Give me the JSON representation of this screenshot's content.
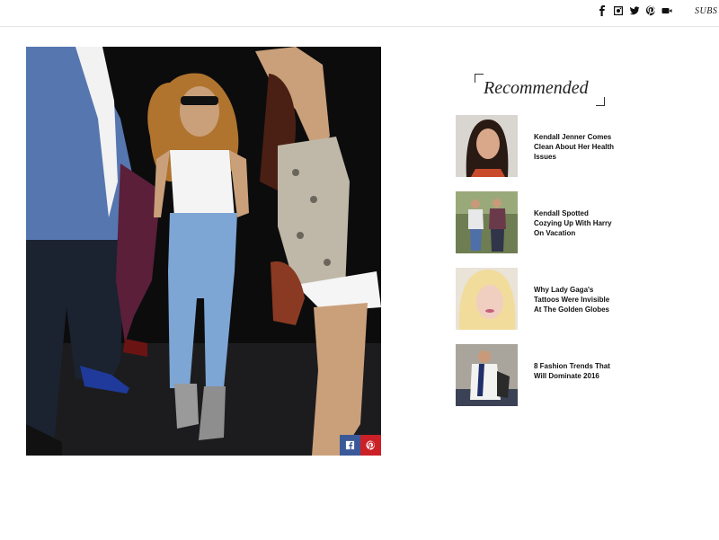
{
  "header": {
    "social_icons": [
      "facebook-icon",
      "instagram-icon",
      "twitter-icon",
      "pinterest-icon",
      "youtube-icon"
    ],
    "subscribe_label": "SUBS"
  },
  "hero": {
    "share_buttons": [
      "facebook-share-icon",
      "pinterest-share-icon"
    ],
    "colors": {
      "facebook": "#3b5998",
      "pinterest": "#cb2027"
    }
  },
  "recommended": {
    "title": "Recommended",
    "items": [
      {
        "title": "Kendall Jenner Comes Clean About Her Health Issues"
      },
      {
        "title": "Kendall Spotted Cozying Up With Harry On Vacation"
      },
      {
        "title": "Why Lady Gaga's Tattoos Were Invisible At The Golden Globes"
      },
      {
        "title": "8 Fashion Trends That Will Dominate 2016"
      }
    ]
  }
}
